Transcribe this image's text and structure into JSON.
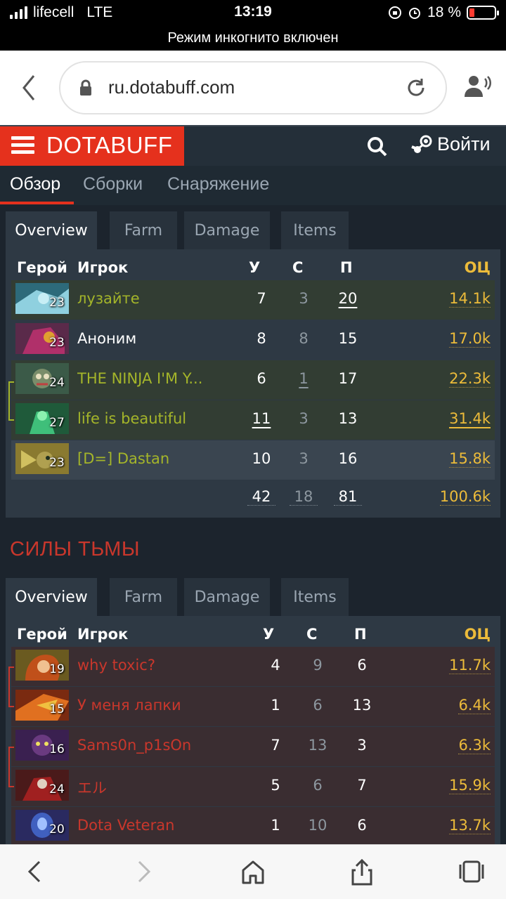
{
  "status_bar": {
    "carrier": "lifecell",
    "network": "LTE",
    "time": "13:19",
    "battery": "18 %"
  },
  "incognito_text": "Режим инкогнито включен",
  "browser": {
    "url": "ru.dotabuff.com"
  },
  "site": {
    "logo": "DOTABUFF",
    "login": "Войти",
    "tabs": [
      "Обзор",
      "Сборки",
      "Снаряжение"
    ],
    "active_tab": "Обзор"
  },
  "subtabs": [
    "Overview",
    "Farm",
    "Damage",
    "Items"
  ],
  "columns": {
    "hero": "Герой",
    "player": "Игрок",
    "kills": "У",
    "deaths": "С",
    "assists": "П",
    "networth": "ОЦ"
  },
  "colors": {
    "radiant": "#a4b52a",
    "dire": "#c9372c",
    "gold": "#ecbb3a",
    "brand": "#e5311d"
  },
  "radiant": {
    "players": [
      {
        "name": "лузайте",
        "level": "23",
        "k": "7",
        "d": "3",
        "a": "20",
        "nw": "14.1k",
        "hero_icon": "hero-portrait-icon"
      },
      {
        "name": "Аноним",
        "level": "23",
        "k": "8",
        "d": "8",
        "a": "15",
        "nw": "17.0k",
        "hero_icon": "hero-portrait-icon"
      },
      {
        "name": "THE NINJA I'M Y...",
        "level": "24",
        "k": "6",
        "d": "1",
        "a": "17",
        "nw": "22.3k",
        "hero_icon": "hero-portrait-icon"
      },
      {
        "name": "life is beautiful",
        "level": "27",
        "k": "11",
        "d": "3",
        "a": "13",
        "nw": "31.4k",
        "hero_icon": "hero-portrait-icon"
      },
      {
        "name": "[D=] Dastan",
        "level": "23",
        "k": "10",
        "d": "3",
        "a": "16",
        "nw": "15.8k",
        "hero_icon": "hero-portrait-icon"
      }
    ],
    "totals": {
      "k": "42",
      "d": "18",
      "a": "81",
      "nw": "100.6k"
    }
  },
  "dire": {
    "title": "СИЛЫ ТЬМЫ",
    "players": [
      {
        "name": "why toxic?",
        "level": "19",
        "k": "4",
        "d": "9",
        "a": "6",
        "nw": "11.7k",
        "hero_icon": "hero-portrait-icon"
      },
      {
        "name": "У меня лапки",
        "level": "15",
        "k": "1",
        "d": "6",
        "a": "13",
        "nw": "6.4k",
        "hero_icon": "hero-portrait-icon"
      },
      {
        "name": "Sams0n_p1sOn",
        "level": "16",
        "k": "7",
        "d": "13",
        "a": "3",
        "nw": "6.3k",
        "hero_icon": "hero-portrait-icon"
      },
      {
        "name": "エル",
        "level": "24",
        "k": "5",
        "d": "6",
        "a": "7",
        "nw": "15.9k",
        "hero_icon": "hero-portrait-icon"
      },
      {
        "name": "Dota Veteran",
        "level": "20",
        "k": "1",
        "d": "10",
        "a": "6",
        "nw": "13.7k",
        "hero_icon": "hero-portrait-icon"
      }
    ]
  }
}
